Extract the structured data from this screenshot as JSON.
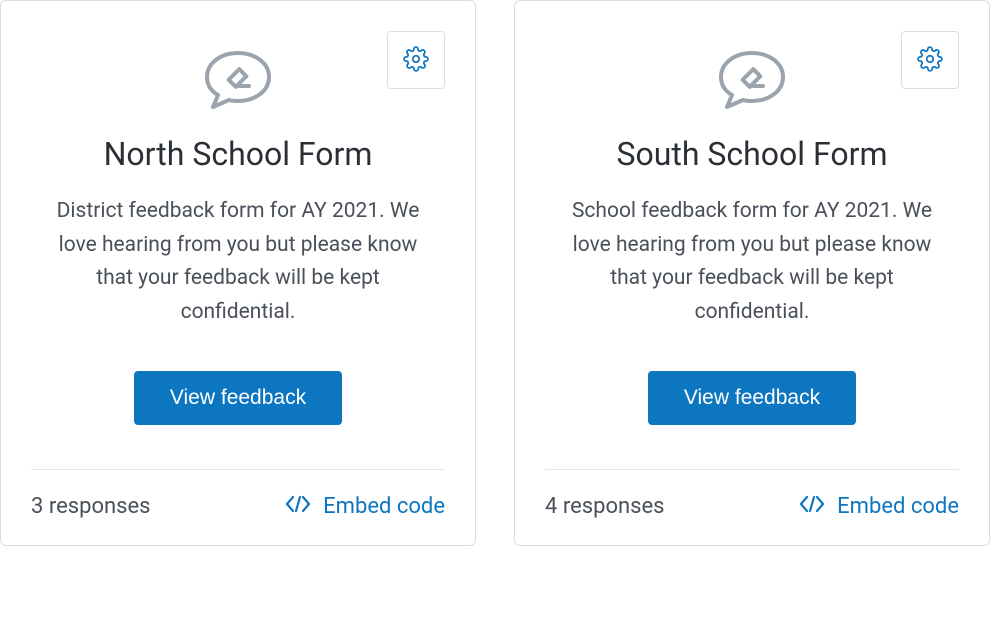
{
  "cards": [
    {
      "title": "North School Form",
      "description": "District feedback form for AY 2021. We love hearing from you but please know that your feedback will be kept confidential.",
      "view_label": "View feedback",
      "responses": "3 responses",
      "embed_label": "Embed code"
    },
    {
      "title": "South School Form",
      "description": "School feedback form for AY 2021. We love hearing from you but please know that your feedback will be kept confidential.",
      "view_label": "View feedback",
      "responses": "4 responses",
      "embed_label": "Embed code"
    }
  ],
  "colors": {
    "primary": "#0d76c1",
    "border": "#d8dde3",
    "text": "#4a5059",
    "title": "#2a2f36"
  }
}
